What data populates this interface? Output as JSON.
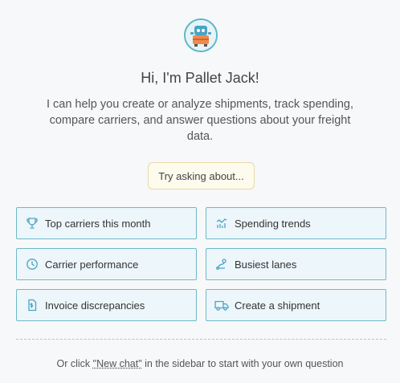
{
  "assistant": {
    "greeting": "Hi, I'm Pallet Jack!",
    "description": "I can help you create or analyze shipments, track spending, compare carriers, and answer questions about your freight data."
  },
  "prompt_label": "Try asking about...",
  "suggestions": [
    {
      "label": "Top carriers this month",
      "icon": "trophy-icon"
    },
    {
      "label": "Spending trends",
      "icon": "chart-icon"
    },
    {
      "label": "Carrier performance",
      "icon": "clock-icon"
    },
    {
      "label": "Busiest lanes",
      "icon": "route-icon"
    },
    {
      "label": "Invoice discrepancies",
      "icon": "invoice-icon"
    },
    {
      "label": "Create a shipment",
      "icon": "truck-icon"
    }
  ],
  "footer": {
    "before": "Or click ",
    "link": "\"New chat\"",
    "after": " in the sidebar to start with your own question"
  },
  "colors": {
    "accent": "#5db6c8",
    "card_bg": "#edf6fa",
    "pill_bg": "#fdfbed",
    "pill_border": "#e7d9a4"
  }
}
